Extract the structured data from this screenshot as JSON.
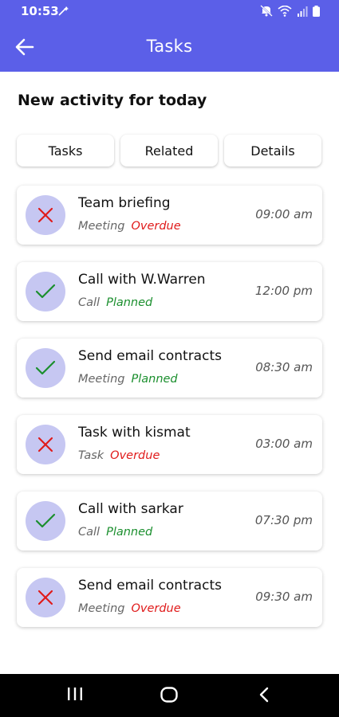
{
  "status_bar": {
    "time": "10:53"
  },
  "app_bar": {
    "title": "Tasks"
  },
  "section_title": "New activity for today",
  "tabs": [
    {
      "label": "Tasks"
    },
    {
      "label": "Related"
    },
    {
      "label": "Details"
    }
  ],
  "activities": [
    {
      "title": "Team briefing",
      "type": "Meeting",
      "status": "Overdue",
      "status_color": "#e01b1b",
      "time": "09:00 am",
      "icon": "cross-icon"
    },
    {
      "title": "Call with W.Warren",
      "type": "Call",
      "status": "Planned",
      "status_color": "#1b8f2e",
      "time": "12:00 pm",
      "icon": "check-icon"
    },
    {
      "title": "Send email contracts",
      "type": "Meeting",
      "status": "Planned",
      "status_color": "#1b8f2e",
      "time": "08:30 am",
      "icon": "check-icon"
    },
    {
      "title": "Task with kismat",
      "type": "Task",
      "status": "Overdue",
      "status_color": "#e01b1b",
      "time": "03:00 am",
      "icon": "cross-icon"
    },
    {
      "title": "Call with sarkar",
      "type": "Call",
      "status": "Planned",
      "status_color": "#1b8f2e",
      "time": "07:30 pm",
      "icon": "check-icon"
    },
    {
      "title": "Send email contracts",
      "type": "Meeting",
      "status": "Overdue",
      "status_color": "#e01b1b",
      "time": "09:30 am",
      "icon": "cross-icon"
    }
  ],
  "colors": {
    "accent": "#5b5fe8",
    "icon_circle": "#c6c7f2",
    "overdue": "#e01b1b",
    "planned": "#1b8f2e"
  }
}
